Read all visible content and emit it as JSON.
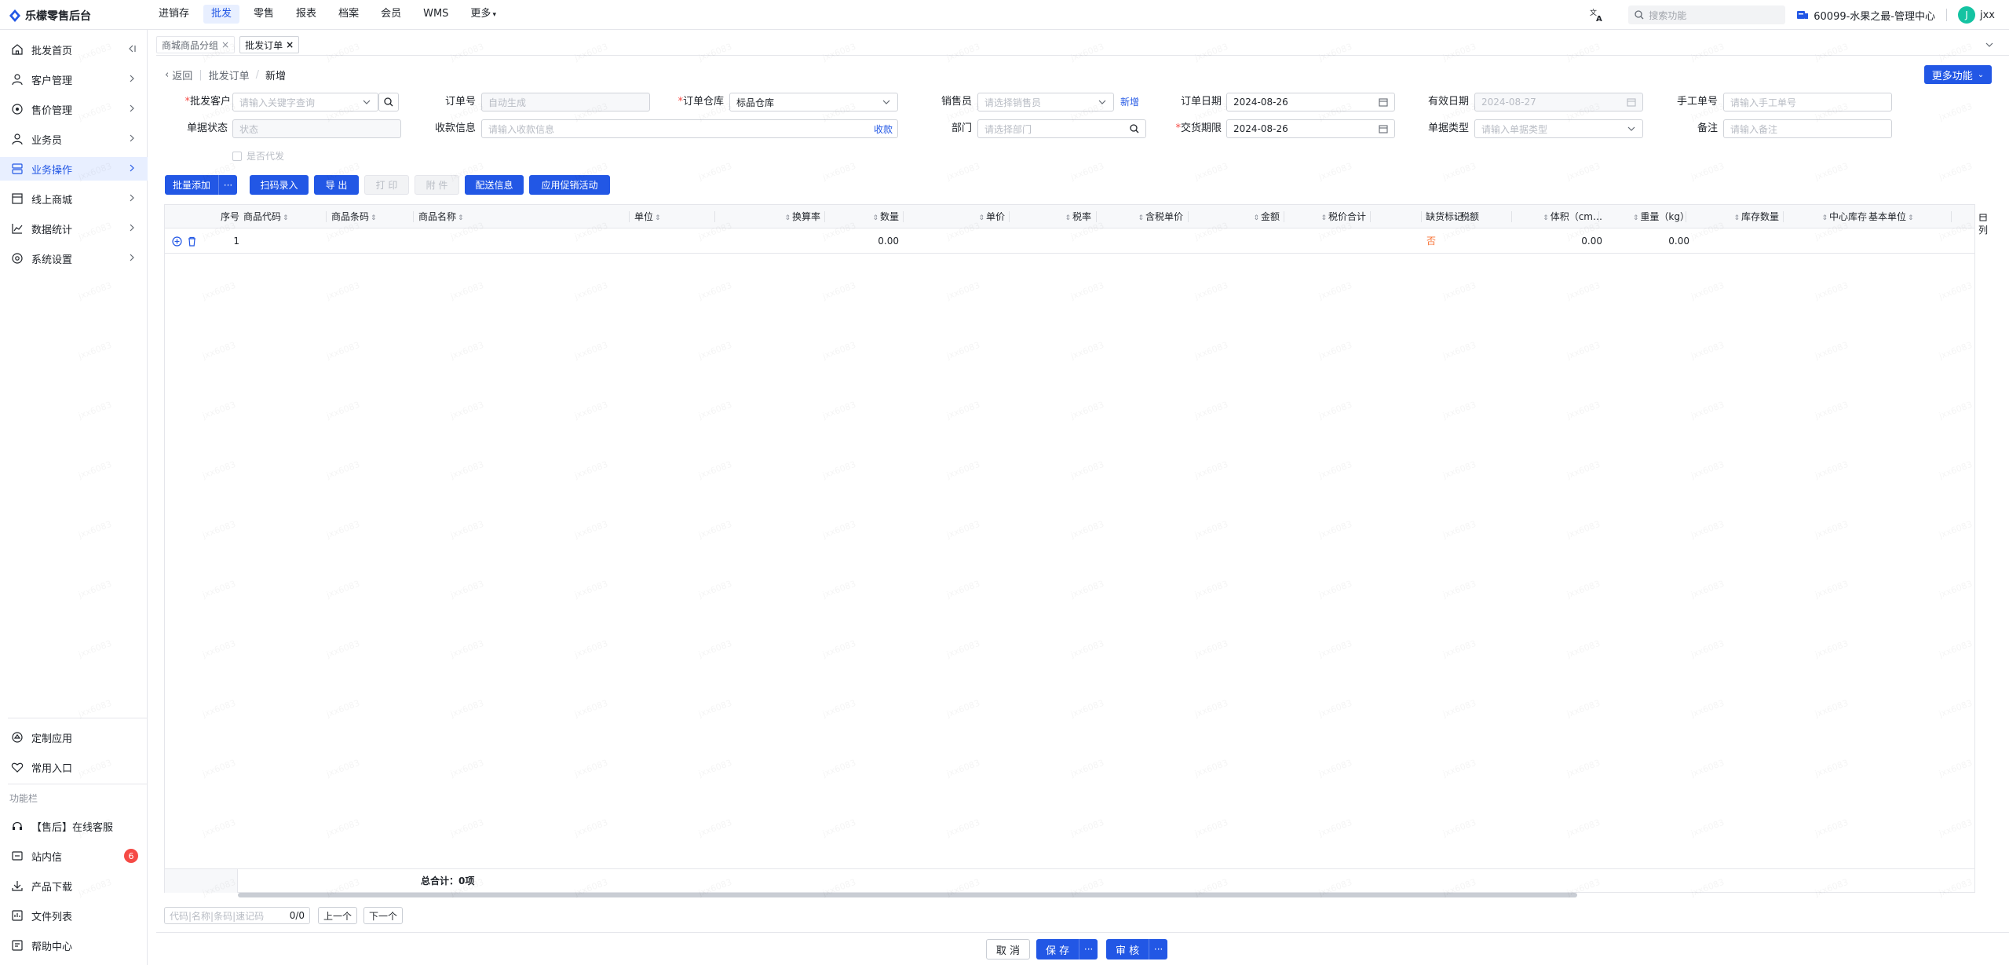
{
  "app": {
    "title": "乐檬零售后台",
    "brand_color": "#2257e5"
  },
  "top_nav": [
    {
      "label": "进销存",
      "active": false
    },
    {
      "label": "批发",
      "active": true
    },
    {
      "label": "零售",
      "active": false
    },
    {
      "label": "报表",
      "active": false
    },
    {
      "label": "档案",
      "active": false
    },
    {
      "label": "会员",
      "active": false
    },
    {
      "label": "WMS",
      "active": false
    },
    {
      "label": "更多",
      "active": false
    }
  ],
  "header": {
    "search_placeholder": "搜索功能",
    "tenant": "60099-水果之最-管理中心",
    "user_initial": "J",
    "user_name": "jxx"
  },
  "sidebar": {
    "items": [
      {
        "label": "批发首页",
        "icon": "home-icon"
      },
      {
        "label": "客户管理",
        "icon": "user-icon"
      },
      {
        "label": "售价管理",
        "icon": "price-icon"
      },
      {
        "label": "业务员",
        "icon": "user-icon"
      },
      {
        "label": "业务操作",
        "icon": "server-icon",
        "active": true
      },
      {
        "label": "线上商城",
        "icon": "shop-icon"
      },
      {
        "label": "数据统计",
        "icon": "chart-icon"
      },
      {
        "label": "系统设置",
        "icon": "settings-icon"
      }
    ],
    "bottom": [
      {
        "label": "定制应用",
        "icon": "custom-app-icon"
      },
      {
        "label": "常用入口",
        "icon": "heart-icon"
      }
    ],
    "function_bar_label": "功能栏",
    "tools": [
      {
        "label": "【售后】在线客服",
        "icon": "headset-icon"
      },
      {
        "label": "站内信",
        "icon": "mail-icon",
        "badge": "6"
      },
      {
        "label": "产品下载",
        "icon": "download-icon"
      },
      {
        "label": "文件列表",
        "icon": "file-list-icon"
      },
      {
        "label": "帮助中心",
        "icon": "help-icon"
      }
    ]
  },
  "tabs": [
    {
      "label": "商城商品分组",
      "active": false
    },
    {
      "label": "批发订单",
      "active": true
    }
  ],
  "breadcrumb": {
    "back": "返回",
    "parent": "批发订单",
    "current": "新增"
  },
  "more_functions": "更多功能",
  "form": {
    "customer": {
      "label": "批发客户",
      "placeholder": "请输入关键字查询"
    },
    "order_no": {
      "label": "订单号",
      "value": "自动生成"
    },
    "warehouse": {
      "label": "订单仓库",
      "value": "标品仓库"
    },
    "salesman": {
      "label": "销售员",
      "placeholder": "请选择销售员",
      "link": "新增"
    },
    "order_date": {
      "label": "订单日期",
      "value": "2024-08-26"
    },
    "valid_date": {
      "label": "有效日期",
      "value": "2024-08-27"
    },
    "manual_no": {
      "label": "手工单号",
      "placeholder": "请输入手工单号"
    },
    "doc_status": {
      "label": "单据状态",
      "value": "状态"
    },
    "payment_info": {
      "label": "收款信息",
      "placeholder": "请输入收款信息",
      "link": "收款"
    },
    "department": {
      "label": "部门",
      "placeholder": "请选择部门"
    },
    "delivery_date": {
      "label": "交货期限",
      "value": "2024-08-26"
    },
    "doc_type": {
      "label": "单据类型",
      "placeholder": "请输入单据类型"
    },
    "remark": {
      "label": "备注",
      "placeholder": "请输入备注"
    },
    "consign_checkbox": "是否代发"
  },
  "actions": {
    "batch_add": "批量添加",
    "scan_entry": "扫码录入",
    "export": "导 出",
    "print": "打 印",
    "attachment": "附 件",
    "delivery_info": "配送信息",
    "apply_promo": "应用促销活动"
  },
  "grid": {
    "columns": [
      "序号",
      "商品代码",
      "商品条码",
      "商品名称",
      "单位",
      "换算率",
      "数量",
      "单价",
      "税率",
      "含税单价",
      "金额",
      "税价合计",
      "税额",
      "缺货标记",
      "体积（cm…",
      "重量（kg）",
      "库存数量",
      "中心库存",
      "基本单位"
    ],
    "rows": [
      {
        "index": "1",
        "quantity": "0.00",
        "stockout": "否",
        "volume": "0.00",
        "weight": "0.00"
      }
    ],
    "total": "总合计：0项",
    "column_setting": "列"
  },
  "find": {
    "placeholder": "代码|名称|条码|速记码",
    "counter": "0/0",
    "prev": "上一个",
    "next": "下一个"
  },
  "footer": {
    "cancel": "取 消",
    "save": "保 存",
    "audit": "审 核"
  },
  "watermark": "jxx6083"
}
